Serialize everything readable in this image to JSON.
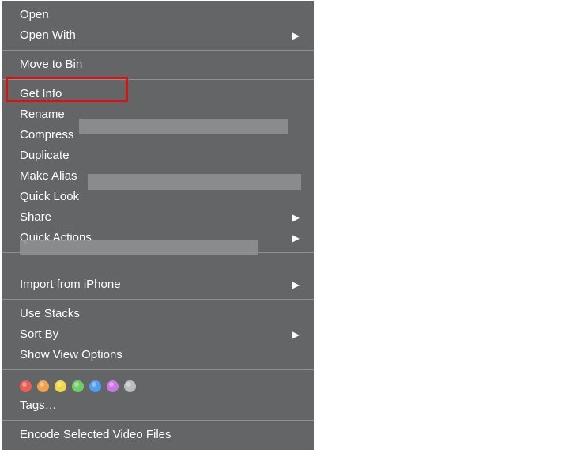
{
  "menu": {
    "open": "Open",
    "open_with": "Open With",
    "move_to_bin": "Move to Bin",
    "get_info": "Get Info",
    "rename": "Rename",
    "compress": "Compress",
    "duplicate": "Duplicate",
    "make_alias": "Make Alias",
    "quick_look": "Quick Look",
    "share": "Share",
    "quick_actions": "Quick Actions",
    "import_iphone": "Import from iPhone",
    "use_stacks": "Use Stacks",
    "sort_by": "Sort By",
    "show_view_options": "Show View Options",
    "tags_label": "Tags…",
    "encode_video": "Encode Selected Video Files"
  },
  "tags": {
    "colors": [
      "#eb5d55",
      "#f0a34b",
      "#f0d74b",
      "#6ed064",
      "#4f9ef0",
      "#c977e7",
      "#bcbcbc"
    ]
  }
}
